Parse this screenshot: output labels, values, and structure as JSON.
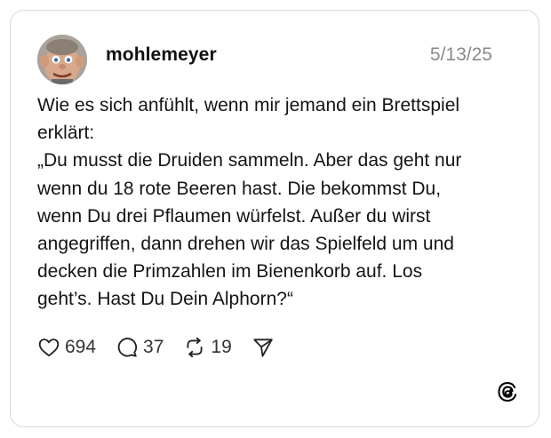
{
  "post": {
    "username": "mohlemeyer",
    "date": "5/13/25",
    "text": "Wie es sich anfühlt, wenn mir jemand ein Brettspiel\nerklärt:\n„Du musst die Druiden sammeln. Aber das geht nur\nwenn du 18 rote Beeren hast. Die bekommst Du,\nwenn Du drei Pflaumen würfelst. Außer du wirst\nangegriffen, dann drehen wir das Spielfeld um und\ndecken die Primzahlen im Bienenkorb auf. Los\ngeht’s. Hast Du Dein Alphorn?“"
  },
  "actions": {
    "likes": "694",
    "replies": "37",
    "reposts": "19"
  },
  "icons": {
    "like": "heart-icon",
    "reply": "speech-bubble-icon",
    "repost": "repost-arrows-icon",
    "share": "send-icon",
    "brand": "threads-logo-icon"
  },
  "colors": {
    "card_border": "#d9d9d9",
    "muted_text": "#8a8a8a",
    "text": "#141414"
  }
}
